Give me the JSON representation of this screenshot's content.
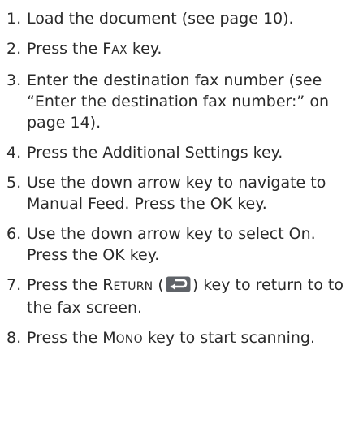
{
  "steps": [
    {
      "number": "1.",
      "text": "Load the document (see page 10)."
    },
    {
      "number": "2.",
      "before": "Press the ",
      "key_first": "F",
      "key_rest": "AX",
      "after": " key."
    },
    {
      "number": "3.",
      "text": "Enter the destination fax number (see “Enter the destination fax number:” on page 14)."
    },
    {
      "number": "4.",
      "text": "Press the Additional Settings key."
    },
    {
      "number": "5.",
      "text": "Use the down arrow key to navigate to Manual Feed. Press the OK key."
    },
    {
      "number": "6.",
      "text": "Use the down arrow key to select On. Press the OK key."
    },
    {
      "number": "7.",
      "before": "Press the ",
      "key_first": "R",
      "key_rest": "ETURN",
      "open_paren": " (",
      "icon": "return-arrow-icon",
      "after": ") key to return to to the fax screen."
    },
    {
      "number": "8.",
      "before": "Press the ",
      "key_first": "M",
      "key_rest": "ONO",
      "after": " key to start scanning."
    }
  ],
  "colors": {
    "text": "#2a2a2a",
    "icon_fill": "#5f6368",
    "icon_arrow": "#ffffff"
  }
}
